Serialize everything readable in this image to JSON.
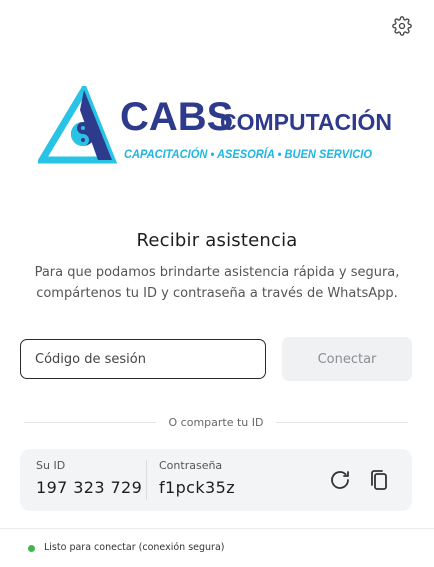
{
  "logo": {
    "brand": "CABS",
    "brand_suffix": "COMPUTACIÓN",
    "tagline": "CAPACITACIÓN • ASESORÍA • BUEN SERVICIO",
    "colors": {
      "navy": "#2e3a8c",
      "cyan": "#29c3e6",
      "text_cyan": "#1fb6e0"
    }
  },
  "header": {
    "settings_icon": "gear-icon"
  },
  "main": {
    "title": "Recibir asistencia",
    "description": "Para que podamos brindarte asistencia rápida y segura, compártenos tu ID y contraseña a través de WhatsApp."
  },
  "session": {
    "placeholder": "Código de sesión",
    "value": "",
    "connect_label": "Conectar"
  },
  "share": {
    "divider_text": "O comparte tu ID",
    "id_label": "Su ID",
    "id_value": "197 323 729",
    "password_label": "Contraseña",
    "password_value": "f1pck35z",
    "refresh_icon": "refresh-icon",
    "copy_icon": "copy-icon"
  },
  "status": {
    "text": "Listo para conectar (conexión segura)",
    "color": "#43b54b"
  }
}
